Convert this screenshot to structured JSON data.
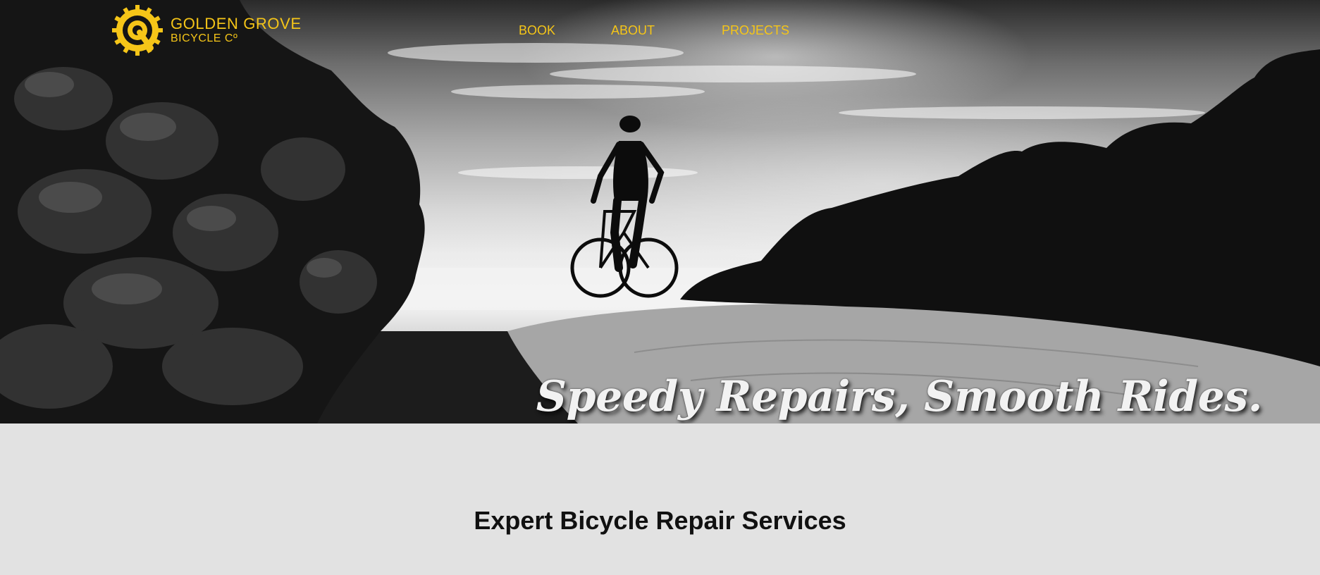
{
  "brand": {
    "name_line1": "GOLDEN GROVE",
    "name_line2": "BICYCLE Cº",
    "logo_icon": "gear-icon",
    "accent_color": "#f5c518"
  },
  "nav": {
    "items": [
      {
        "label": "BOOK"
      },
      {
        "label": "ABOUT"
      },
      {
        "label": "PROJECTS"
      }
    ]
  },
  "hero": {
    "tagline": "Speedy Repairs, Smooth Rides.",
    "image": "black-and-white photo of a cyclist silhouetted on a rocky road"
  },
  "services": {
    "heading": "Expert Bicycle Repair Services"
  },
  "colors": {
    "page_background": "#e2e2e2",
    "heading_text": "#111111"
  }
}
